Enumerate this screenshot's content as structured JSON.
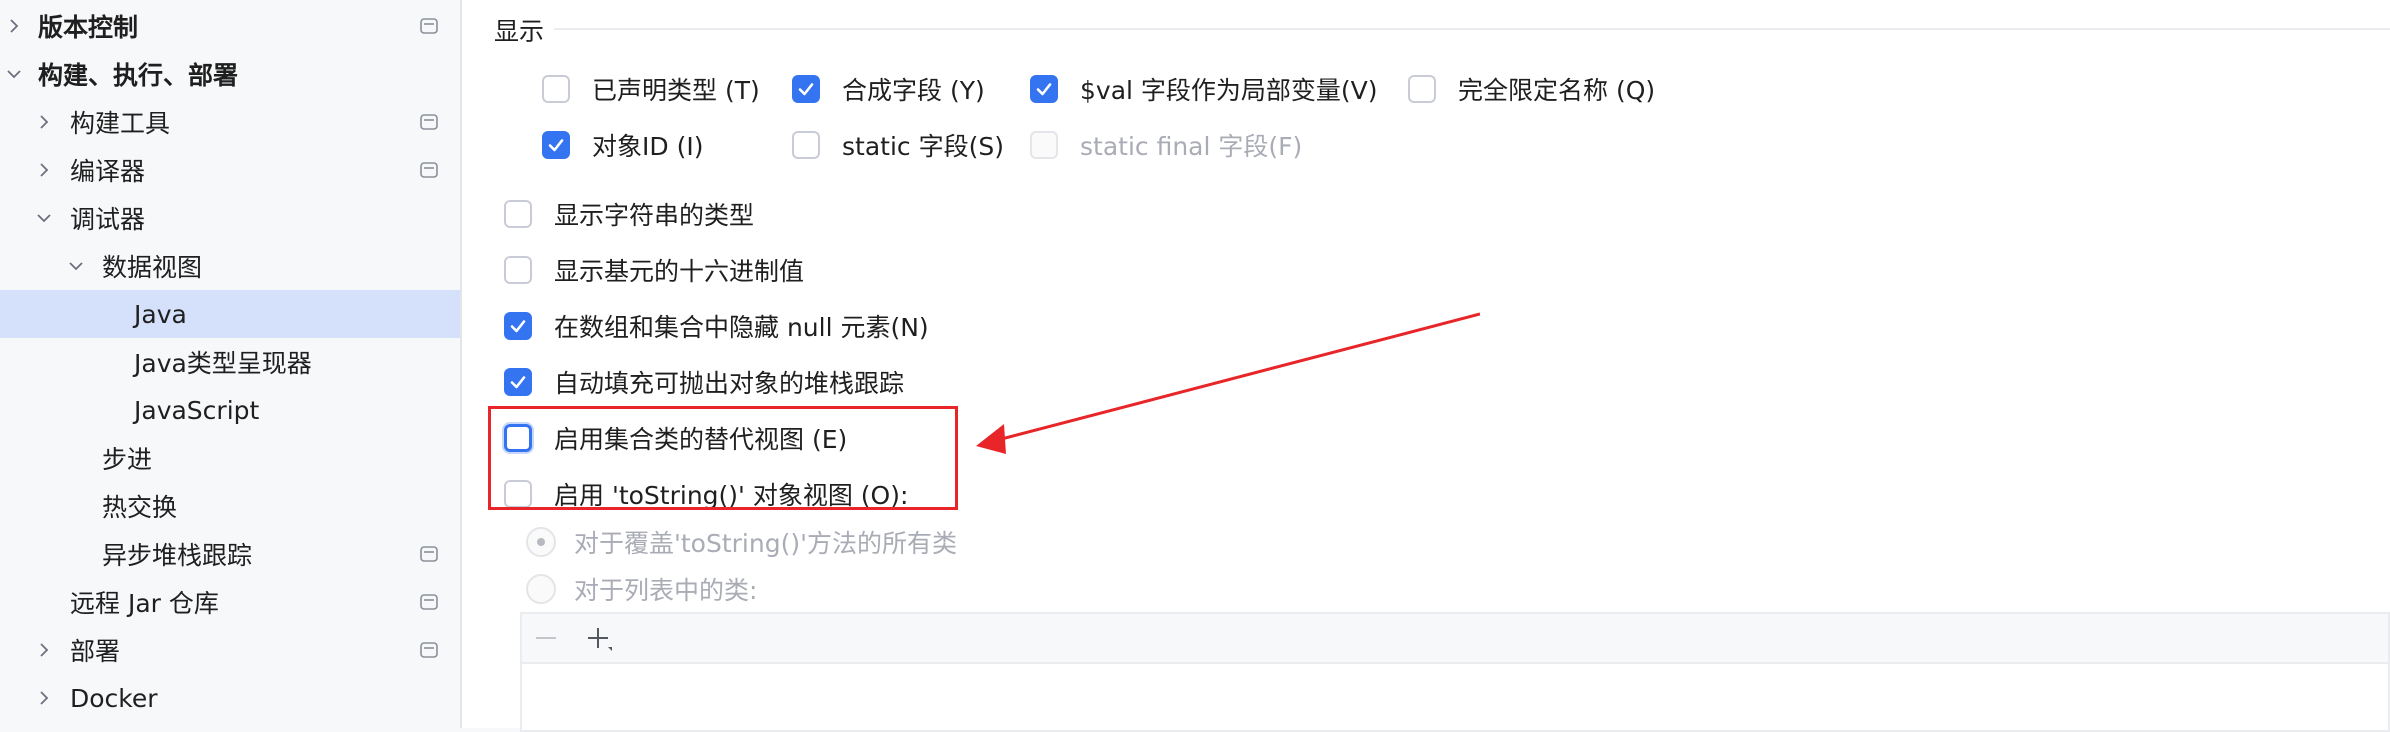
{
  "sidebar": {
    "items": [
      {
        "label": "版本控制",
        "bold": true,
        "chevron": "right",
        "icon": true
      },
      {
        "label": "构建、执行、部署",
        "bold": true,
        "chevron": "down",
        "icon": false
      },
      {
        "label": "构建工具",
        "bold": false,
        "chevron": "right",
        "icon": true
      },
      {
        "label": "编译器",
        "bold": false,
        "chevron": "right",
        "icon": true
      },
      {
        "label": "调试器",
        "bold": false,
        "chevron": "down",
        "icon": false
      },
      {
        "label": "数据视图",
        "bold": false,
        "chevron": "down",
        "icon": false
      },
      {
        "label": "Java",
        "bold": false,
        "chevron": "none",
        "icon": false,
        "selected": true
      },
      {
        "label": "Java类型呈现器",
        "bold": false,
        "chevron": "none",
        "icon": false
      },
      {
        "label": "JavaScript",
        "bold": false,
        "chevron": "none",
        "icon": false
      },
      {
        "label": "步进",
        "bold": false,
        "chevron": "none",
        "icon": false
      },
      {
        "label": "热交换",
        "bold": false,
        "chevron": "none",
        "icon": false
      },
      {
        "label": "异步堆栈跟踪",
        "bold": false,
        "chevron": "none",
        "icon": true
      },
      {
        "label": "远程 Jar 仓库",
        "bold": false,
        "chevron": "none",
        "icon": true
      },
      {
        "label": "部署",
        "bold": false,
        "chevron": "right",
        "icon": true
      },
      {
        "label": "Docker",
        "bold": false,
        "chevron": "right",
        "icon": false
      }
    ]
  },
  "main": {
    "section_title": "显示",
    "display_options": [
      {
        "label": "已声明类型 (T)",
        "checked": false
      },
      {
        "label": "合成字段 (Y)",
        "checked": true
      },
      {
        "label": "$val 字段作为局部变量(V)",
        "checked": true
      },
      {
        "label": "完全限定名称 (Q)",
        "checked": false
      },
      {
        "label": "对象ID (I)",
        "checked": true
      },
      {
        "label": "static 字段(S)",
        "checked": false
      },
      {
        "label": "static final 字段(F)",
        "checked": false,
        "disabled": true
      }
    ],
    "options": [
      {
        "label": "显示字符串的类型",
        "checked": false
      },
      {
        "label": "显示基元的十六进制值",
        "checked": false
      },
      {
        "label": "在数组和集合中隐藏 null 元素(N)",
        "checked": true
      },
      {
        "label": "自动填充可抛出对象的堆栈跟踪",
        "checked": true
      },
      {
        "label": "启用集合类的替代视图 (E)",
        "checked": false,
        "focused": true
      },
      {
        "label": "启用 'toString()' 对象视图 (O):",
        "checked": false
      }
    ],
    "radios": [
      {
        "label": "对于覆盖'toString()'方法的所有类",
        "selected": true
      },
      {
        "label": "对于列表中的类:",
        "selected": false
      }
    ],
    "toolbar": {
      "remove_icon": "minus-icon",
      "add_icon": "plus-icon"
    }
  },
  "colors": {
    "accent": "#3574f0",
    "selection": "#d5e1fb",
    "annotation": "#e8262a"
  }
}
